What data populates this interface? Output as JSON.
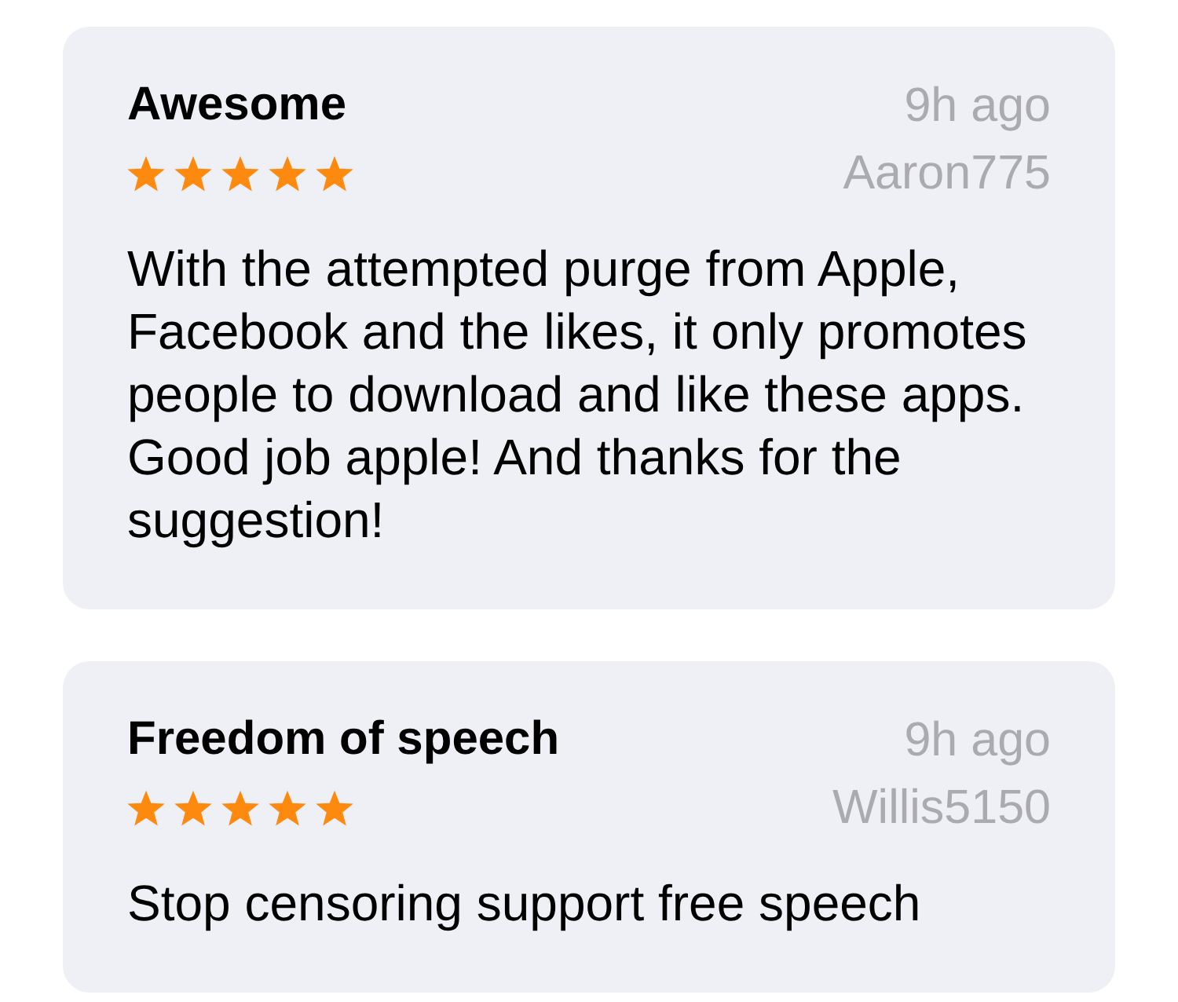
{
  "reviews": [
    {
      "title": "Awesome",
      "time": "9h ago",
      "stars": 5,
      "author": "Aaron775",
      "body": "With the attempted purge from Apple, Facebook and the likes, it only promotes people to download and like these apps. Good job apple! And thanks for the suggestion!"
    },
    {
      "title": "Freedom of speech",
      "time": "9h ago",
      "stars": 5,
      "author": "Willis5150",
      "body": "Stop censoring support free speech"
    }
  ]
}
